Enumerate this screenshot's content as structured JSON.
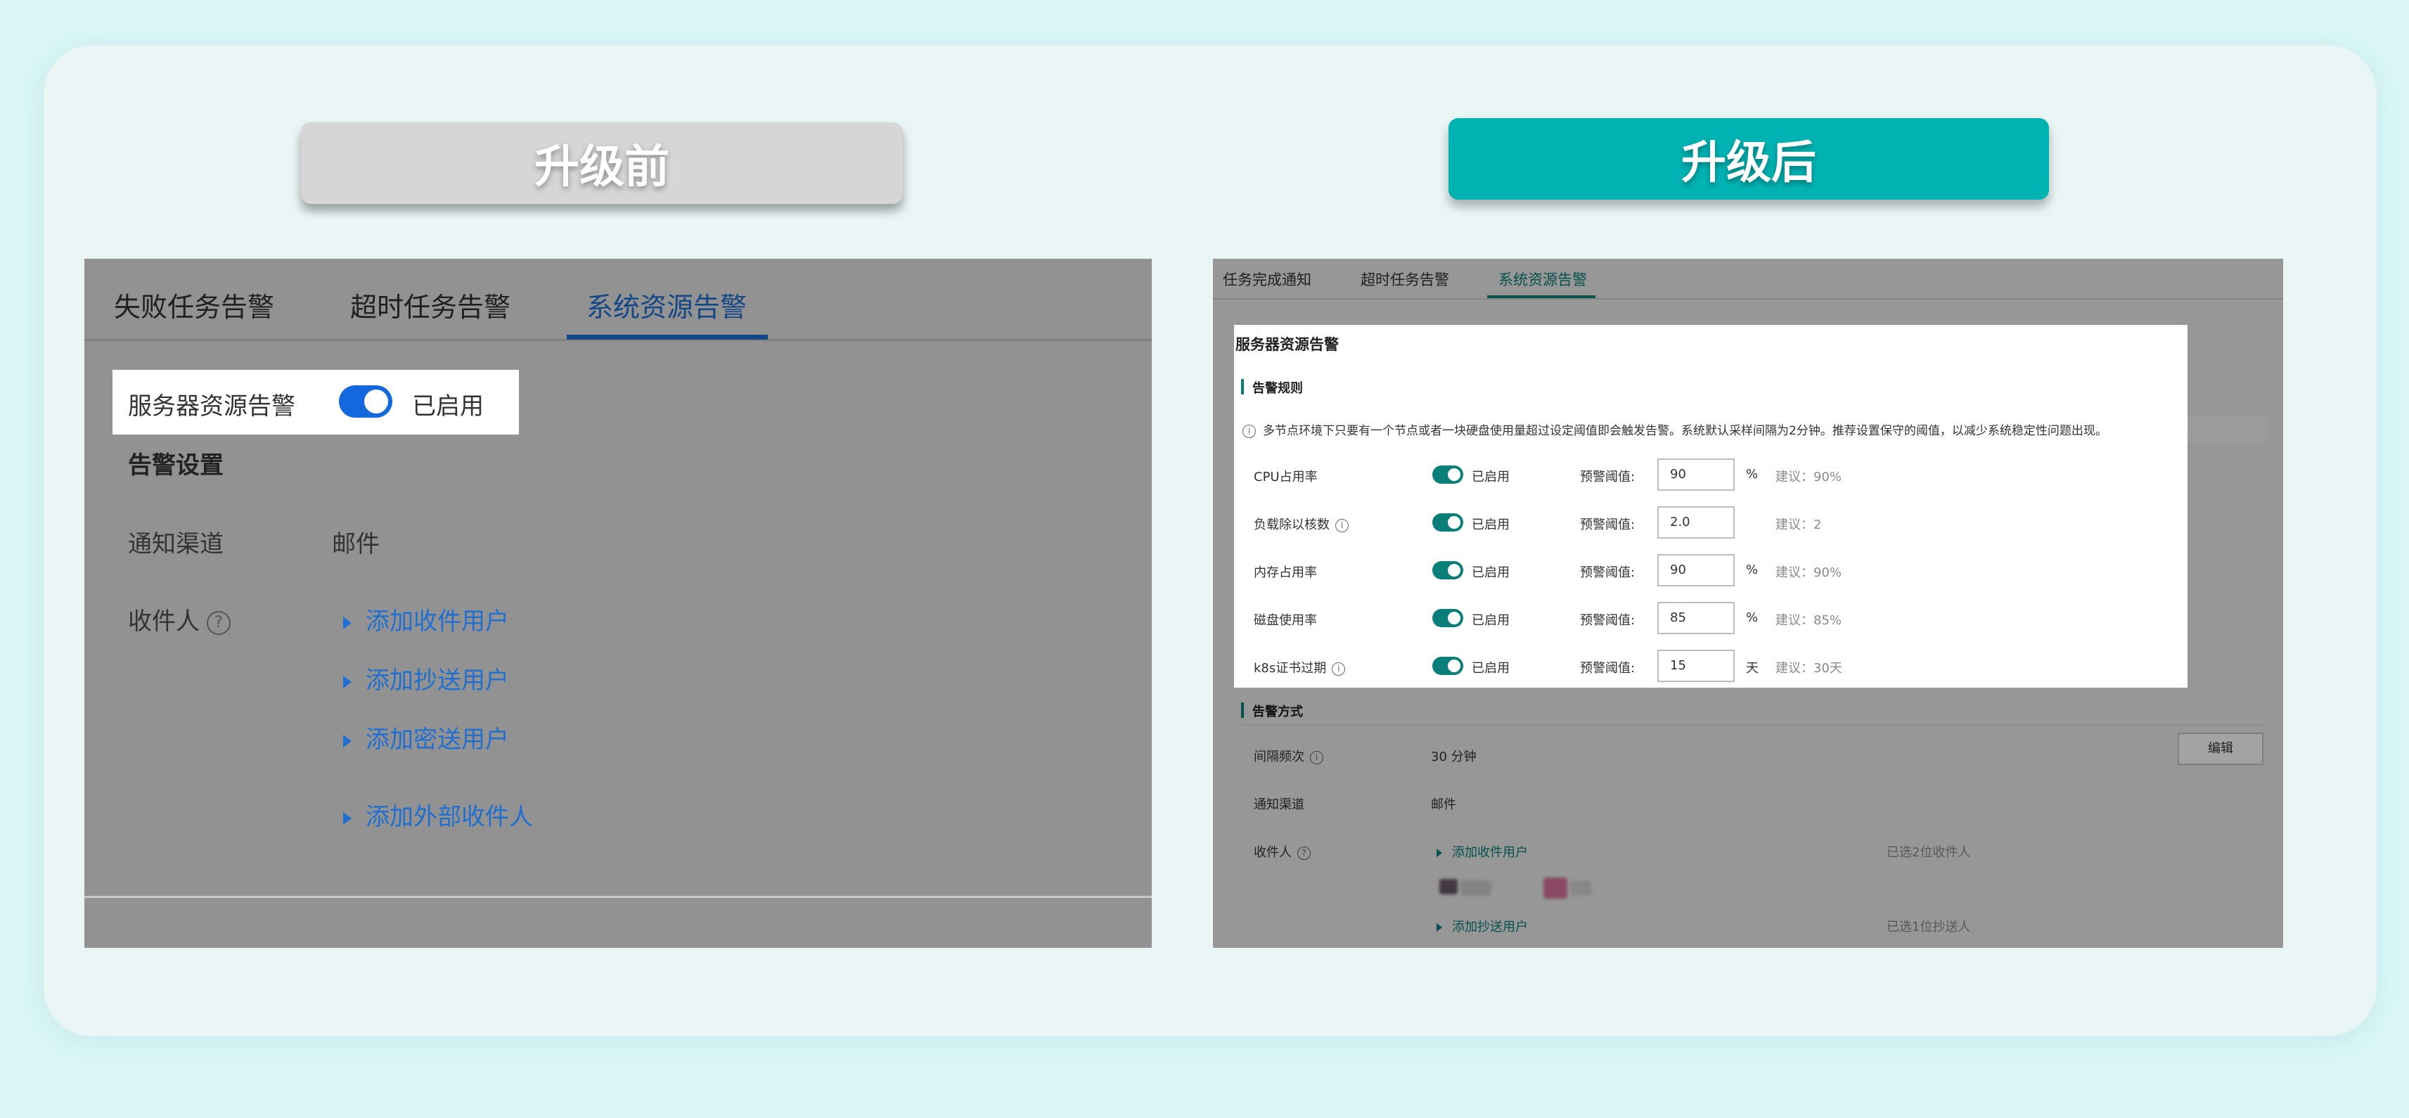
{
  "banners": {
    "before": "升级前",
    "after": "升级后"
  },
  "colors": {
    "page_bg": "#d9f5f6",
    "after_accent": "#00b3b3",
    "before_gray": "#d6d6d6",
    "old_blue": "#1f6fd2",
    "new_teal": "#0a7f7a"
  },
  "before": {
    "tabs": [
      "失败任务告警",
      "超时任务告警",
      "系统资源告警"
    ],
    "active_tab": "系统资源告警",
    "server_alert": {
      "label": "服务器资源告警",
      "toggle_on": true,
      "status": "已启用"
    },
    "alert_settings_title": "告警设置",
    "channel": {
      "label": "通知渠道",
      "value": "邮件"
    },
    "recipients": {
      "label": "收件人",
      "help_icon": "question-circle-icon",
      "links": [
        "添加收件用户",
        "添加抄送用户",
        "添加密送用户",
        "添加外部收件人"
      ]
    }
  },
  "after": {
    "tabs": [
      "任务完成通知",
      "超时任务告警",
      "系统资源告警"
    ],
    "active_tab": "系统资源告警",
    "section_title": "服务器资源告警",
    "rules_title": "告警规则",
    "info": "多节点环境下只要有一个节点或者一块硬盘使用量超过设定阈值即会触发告警。系统默认采样间隔为2分钟。推荐设置保守的阈值，以减少系统稳定性问题出现。",
    "threshold_label": "预警阈值:",
    "rules": [
      {
        "name": "CPU占用率",
        "info_icon": false,
        "status": "已启用",
        "value": "90",
        "unit": "%",
        "suggest": "建议：90%"
      },
      {
        "name": "负载除以核数",
        "info_icon": true,
        "status": "已启用",
        "value": "2.0",
        "unit": "",
        "suggest": "建议：2"
      },
      {
        "name": "内存占用率",
        "info_icon": false,
        "status": "已启用",
        "value": "90",
        "unit": "%",
        "suggest": "建议：90%"
      },
      {
        "name": "磁盘使用率",
        "info_icon": false,
        "status": "已启用",
        "value": "85",
        "unit": "%",
        "suggest": "建议：85%"
      },
      {
        "name": "k8s证书过期",
        "info_icon": true,
        "status": "已启用",
        "value": "15",
        "unit": "天",
        "suggest": "建议：30天"
      }
    ],
    "method_title": "告警方式",
    "interval": {
      "label": "间隔频次",
      "value": "30 分钟"
    },
    "edit_button": "编辑",
    "channel": {
      "label": "通知渠道",
      "value": "邮件"
    },
    "recipients": {
      "label": "收件人",
      "add_to": "添加收件用户",
      "to_count": "已选2位收件人",
      "add_cc": "添加抄送用户",
      "cc_count": "已选1位抄送人"
    }
  }
}
